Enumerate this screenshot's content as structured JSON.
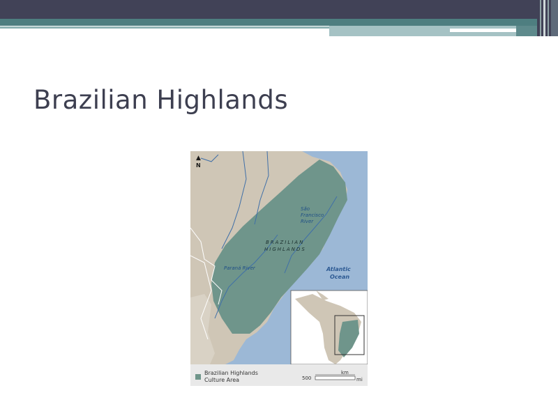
{
  "slide": {
    "title": "Brazilian Highlands"
  },
  "map": {
    "north_label": "N",
    "region_label_line1": "BRAZILIAN",
    "region_label_line2": "HIGHLANDS",
    "river_sao_francisco_line1": "São",
    "river_sao_francisco_line2": "Francisco",
    "river_sao_francisco_line3": "River",
    "river_parana": "Paraná River",
    "ocean_line1": "Atlantic",
    "ocean_line2": "Ocean",
    "legend_line1": "Brazilian Highlands",
    "legend_line2": "Culture Area",
    "scale_value": "500",
    "scale_km": "km",
    "scale_mi": "mi",
    "colors": {
      "land": "#cfc6b6",
      "highlands": "#6f958b",
      "ocean": "#9cb8d6",
      "rivers": "#3f6fa8"
    }
  }
}
